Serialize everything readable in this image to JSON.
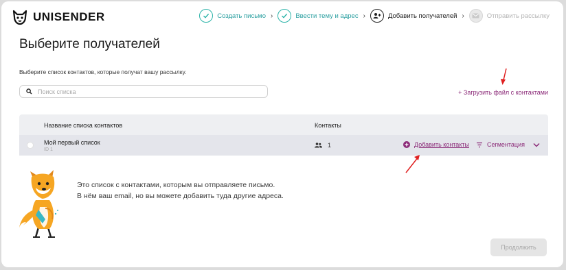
{
  "brand": {
    "name": "UNISENDER",
    "logo_icon": "fox-logo-icon"
  },
  "steps": [
    {
      "label": "Создать письмо",
      "state": "done",
      "icon": "check-icon"
    },
    {
      "label": "Ввести тему и адрес",
      "state": "done",
      "icon": "check-icon"
    },
    {
      "label": "Добавить получателей",
      "state": "active",
      "icon": "add-user-icon"
    },
    {
      "label": "Отправить рассылку",
      "state": "pending",
      "icon": "mail-icon"
    }
  ],
  "step_separator": "›",
  "page": {
    "title": "Выберите получателей",
    "subtitle": "Выберите список контактов, которые получат вашу рассылку."
  },
  "search": {
    "placeholder": "Поиск списка",
    "value": ""
  },
  "upload_link": "+ Загрузить файл с контактами",
  "table": {
    "columns": [
      "Название списка контактов",
      "Контакты"
    ],
    "rows": [
      {
        "name": "Мой первый список",
        "id": "ID 1",
        "contacts": "1",
        "actions": {
          "add": "Добавить контакты",
          "segment": "Сегментация"
        }
      }
    ]
  },
  "hint": {
    "line1": "Это список с контактами, которым вы отправляете письмо.",
    "line2": "В нём ваш email, но вы можете добавить туда другие адреса."
  },
  "continue_label": "Продолжить",
  "colors": {
    "accent": "#8b2a78",
    "step_done": "#2bb3a8",
    "annotation_arrow": "#e02020"
  }
}
